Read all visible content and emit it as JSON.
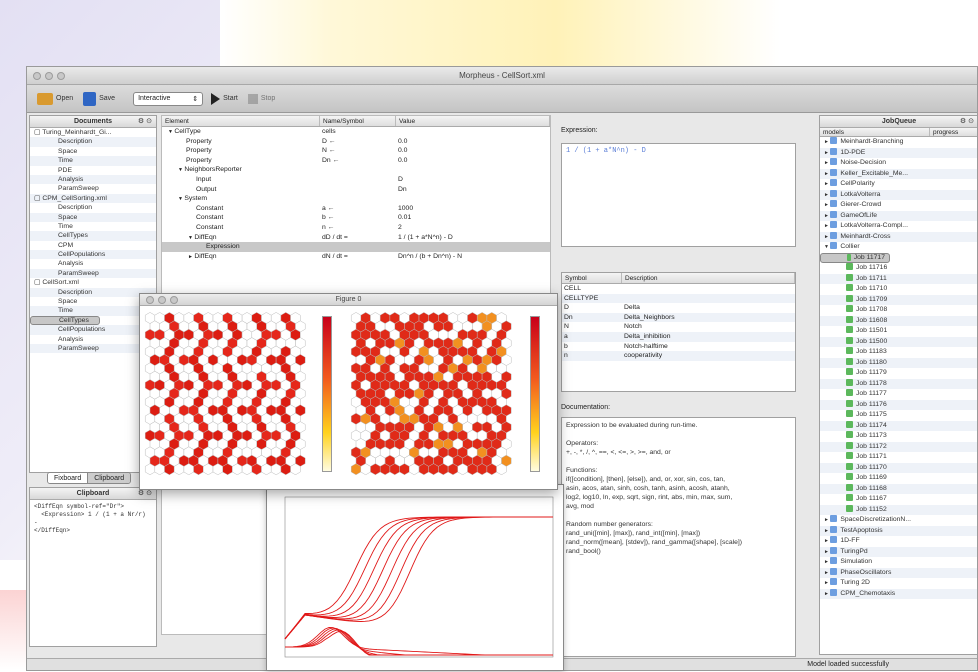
{
  "window": {
    "title": "Morpheus - CellSort.xml"
  },
  "toolbar": {
    "open": "Open",
    "save": "Save",
    "mode": "Interactive",
    "start": "Start",
    "stop": "Stop"
  },
  "documents": {
    "title": "Documents",
    "items": [
      {
        "label": "Turing_Meinhardt_Gi...",
        "level": 0
      },
      {
        "label": "Description",
        "level": 1
      },
      {
        "label": "Space",
        "level": 1
      },
      {
        "label": "Time",
        "level": 1
      },
      {
        "label": "PDE",
        "level": 1
      },
      {
        "label": "Analysis",
        "level": 1
      },
      {
        "label": "ParamSweep",
        "level": 1
      },
      {
        "label": "CPM_CellSorting.xml",
        "level": 0
      },
      {
        "label": "Description",
        "level": 1
      },
      {
        "label": "Space",
        "level": 1
      },
      {
        "label": "Time",
        "level": 1
      },
      {
        "label": "CellTypes",
        "level": 1
      },
      {
        "label": "CPM",
        "level": 1
      },
      {
        "label": "CellPopulations",
        "level": 1
      },
      {
        "label": "Analysis",
        "level": 1
      },
      {
        "label": "ParamSweep",
        "level": 1
      },
      {
        "label": "CellSort.xml",
        "level": 0
      },
      {
        "label": "Description",
        "level": 1
      },
      {
        "label": "Space",
        "level": 1
      },
      {
        "label": "Time",
        "level": 1
      },
      {
        "label": "CellTypes",
        "level": 1
      },
      {
        "label": "CellPopulations",
        "level": 1
      },
      {
        "label": "Analysis",
        "level": 1
      },
      {
        "label": "ParamSweep",
        "level": 1
      }
    ],
    "tabs": [
      "Fixboard",
      "Clipboard"
    ]
  },
  "clipboard": {
    "title": "Clipboard",
    "text": "<DiffEqn symbol-ref=\"Dr\">\n  <Expression> 1 / (1 + a Nr/r) - \n</DiffEqn>"
  },
  "model": {
    "headers": [
      "Element",
      "Name/Symbol",
      "Value"
    ],
    "rows": [
      {
        "el": "CellType",
        "name": "cells",
        "val": "",
        "indent": 0,
        "arrow": "▼"
      },
      {
        "el": "Property",
        "name": "D ←",
        "val": "0.0",
        "indent": 2,
        "arrow": ""
      },
      {
        "el": "Property",
        "name": "N ←",
        "val": "0.0",
        "indent": 2,
        "arrow": ""
      },
      {
        "el": "Property",
        "name": "Dn ←",
        "val": "0.0",
        "indent": 2,
        "arrow": ""
      },
      {
        "el": "NeighborsReporter",
        "name": "",
        "val": "",
        "indent": 1,
        "arrow": "▼"
      },
      {
        "el": "Input",
        "name": "",
        "val": "D",
        "indent": 3,
        "arrow": ""
      },
      {
        "el": "Output",
        "name": "",
        "val": "Dn",
        "indent": 3,
        "arrow": ""
      },
      {
        "el": "System",
        "name": "",
        "val": "",
        "indent": 1,
        "arrow": "▼"
      },
      {
        "el": "Constant",
        "name": "a ←",
        "val": "1000",
        "indent": 3,
        "arrow": ""
      },
      {
        "el": "Constant",
        "name": "b ←",
        "val": "0.01",
        "indent": 3,
        "arrow": ""
      },
      {
        "el": "Constant",
        "name": "n ←",
        "val": "2",
        "indent": 3,
        "arrow": ""
      },
      {
        "el": "DiffEqn",
        "name": "dD / dt =",
        "val": "1 / (1 + a*N^n) - D",
        "indent": 2,
        "arrow": "▼"
      },
      {
        "el": "Expression",
        "name": "",
        "val": "",
        "indent": 4,
        "arrow": ""
      },
      {
        "el": "DiffEqn",
        "name": "dN / dt =",
        "val": "Dn^n / (b + Dn^n) - N",
        "indent": 2,
        "arrow": "►"
      }
    ]
  },
  "expression": {
    "label": "Expression:",
    "value": "1 / (1 + a*N^n) - D"
  },
  "symbols": {
    "headers": [
      "Symbol",
      "Description"
    ],
    "rows": [
      {
        "sym": "CELL",
        "desc": ""
      },
      {
        "sym": "CELLTYPE",
        "desc": ""
      },
      {
        "sym": "D",
        "desc": "Delta"
      },
      {
        "sym": "Dn",
        "desc": "Delta_Neighbors"
      },
      {
        "sym": "N",
        "desc": "Notch"
      },
      {
        "sym": "a",
        "desc": "Delta_inhibition"
      },
      {
        "sym": "b",
        "desc": "Notch-halftime"
      },
      {
        "sym": "n",
        "desc": "cooperativity"
      }
    ]
  },
  "documentation": {
    "label": "Documentation:",
    "text": "Expression to be evaluated during run-time.\n\nOperators:\n+, -, *, /, ^, ==, <, <=, >, >=, and, or\n\nFunctions:\nif([condition], [then], [else]), and, or, xor, sin, cos, tan,\nasin, acos, atan, sinh, cosh, tanh, asinh, acosh, atanh,\nlog2, log10, ln, exp, sqrt, sign, rint, abs, min, max, sum,\navg, mod\n\nRandom number generators:\nrand_uni([min], [max]), rand_int([min], [max])\nrand_norm([mean], [stdev]), rand_gamma([shape], [scale])\nrand_bool()"
  },
  "figure": {
    "title": "Figure 0"
  },
  "jobqueue": {
    "title": "JobQueue",
    "col1": "models",
    "col2": "progress",
    "items": [
      {
        "label": "Meinhardt-Branching",
        "level": 0
      },
      {
        "label": "1D-PDE",
        "level": 0
      },
      {
        "label": "Noise-Decision",
        "level": 0
      },
      {
        "label": "Keller_Excitable_Me...",
        "level": 0
      },
      {
        "label": "CellPolarity",
        "level": 0
      },
      {
        "label": "LotkaVolterra",
        "level": 0
      },
      {
        "label": "Gierer-Crowd",
        "level": 0
      },
      {
        "label": "GameOfLife",
        "level": 0
      },
      {
        "label": "LotkaVolterra-Compl...",
        "level": 0
      },
      {
        "label": "Meinhardt-Cross",
        "level": 0
      },
      {
        "label": "Collier",
        "level": 0
      },
      {
        "label": "Job 11717",
        "level": 1
      },
      {
        "label": "Job 11716",
        "level": 1
      },
      {
        "label": "Job 11711",
        "level": 1
      },
      {
        "label": "Job 11710",
        "level": 1
      },
      {
        "label": "Job 11709",
        "level": 1
      },
      {
        "label": "Job 11708",
        "level": 1
      },
      {
        "label": "Job 11608",
        "level": 1
      },
      {
        "label": "Job 11501",
        "level": 1
      },
      {
        "label": "Job 11500",
        "level": 1
      },
      {
        "label": "Job 11183",
        "level": 1
      },
      {
        "label": "Job 11180",
        "level": 1
      },
      {
        "label": "Job 11179",
        "level": 1
      },
      {
        "label": "Job 11178",
        "level": 1
      },
      {
        "label": "Job 11177",
        "level": 1
      },
      {
        "label": "Job 11176",
        "level": 1
      },
      {
        "label": "Job 11175",
        "level": 1
      },
      {
        "label": "Job 11174",
        "level": 1
      },
      {
        "label": "Job 11173",
        "level": 1
      },
      {
        "label": "Job 11172",
        "level": 1
      },
      {
        "label": "Job 11171",
        "level": 1
      },
      {
        "label": "Job 11170",
        "level": 1
      },
      {
        "label": "Job 11169",
        "level": 1
      },
      {
        "label": "Job 11168",
        "level": 1
      },
      {
        "label": "Job 11167",
        "level": 1
      },
      {
        "label": "Job 11152",
        "level": 1
      },
      {
        "label": "SpaceDiscretizationN...",
        "level": 0
      },
      {
        "label": "TestApoptosis",
        "level": 0
      },
      {
        "label": "1D-FF",
        "level": 0
      },
      {
        "label": "TuringPd",
        "level": 0
      },
      {
        "label": "Simulation",
        "level": 0
      },
      {
        "label": "PhaseOscillators",
        "level": 0
      },
      {
        "label": "Turing 2D",
        "level": 0
      },
      {
        "label": "CPM_Chemotaxis",
        "level": 0
      }
    ]
  },
  "status": {
    "text": "Model loaded successfully"
  }
}
